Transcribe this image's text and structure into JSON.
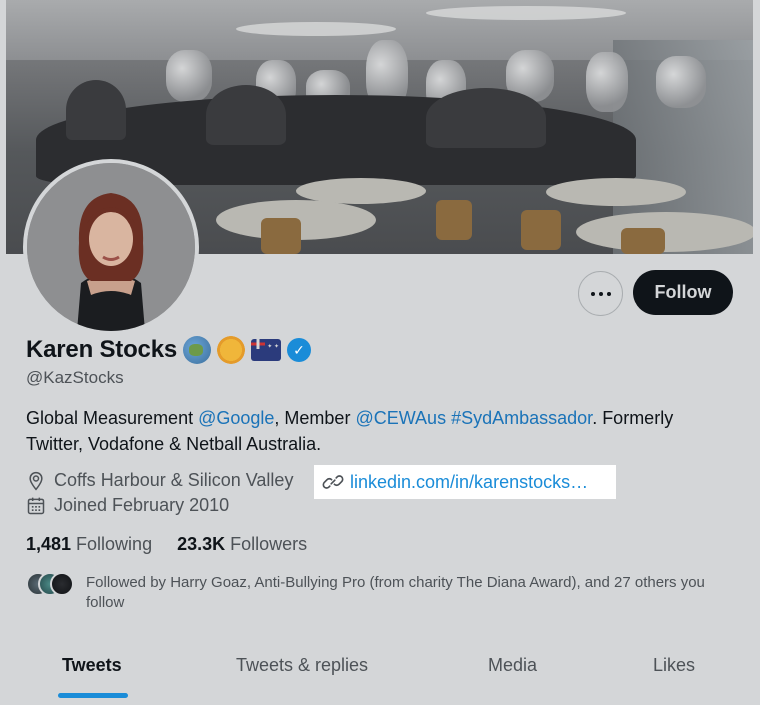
{
  "profile": {
    "name": "Karen Stocks",
    "handle": "@KazStocks",
    "bio": {
      "part1": "Global Measurement ",
      "mention1": "@Google",
      "part2": ", Member ",
      "mention2": "@CEWAus",
      "part3": " ",
      "hashtag": "#SydAmbassador",
      "part4": ". Formerly Twitter, Vodafone & Netball Australia."
    },
    "location": "Coffs Harbour & Silicon Valley",
    "website": "linkedin.com/in/karenstocks…",
    "joined": "Joined February 2010",
    "following_count": "1,481",
    "following_label": "Following",
    "followers_count": "23.3K",
    "followers_label": "Followers",
    "followed_by": "Followed by Harry Goaz, Anti-Bullying Pro (from charity The Diana Award), and 27 others you follow"
  },
  "actions": {
    "follow_label": "Follow"
  },
  "tabs": [
    {
      "label": "Tweets",
      "active": true
    },
    {
      "label": "Tweets & replies",
      "active": false
    },
    {
      "label": "Media",
      "active": false
    },
    {
      "label": "Likes",
      "active": false
    }
  ],
  "colors": {
    "accent": "#1a8cd8",
    "background": "#d4d6d8",
    "text": "#0f1419",
    "secondary_text": "#4d5257"
  }
}
